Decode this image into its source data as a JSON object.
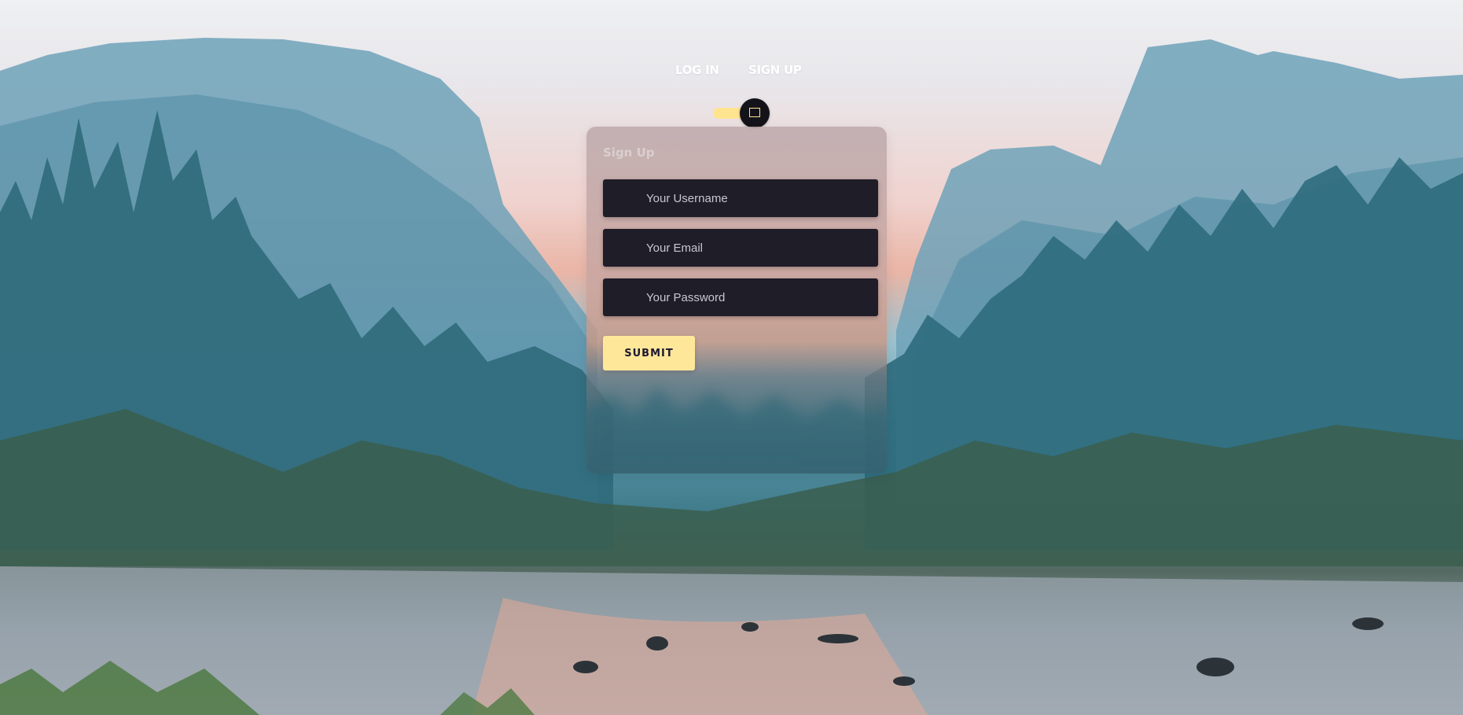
{
  "nav": {
    "login_label": "LOG IN",
    "signup_label": "SIGN UP"
  },
  "toggle": {
    "state": "sign-up",
    "track_color": "#ffe48f",
    "knob_color": "#14131a",
    "knob_icon": "square-icon"
  },
  "form": {
    "title": "Sign Up",
    "username_placeholder": "Your Username",
    "email_placeholder": "Your Email",
    "password_placeholder": "Your Password",
    "submit_label": "SUBMIT"
  },
  "colors": {
    "accent": "#ffe79a",
    "field_background": "#1f1d28",
    "nav_text": "#ffffff"
  },
  "background": {
    "icon": "mountain-lake-landscape"
  }
}
